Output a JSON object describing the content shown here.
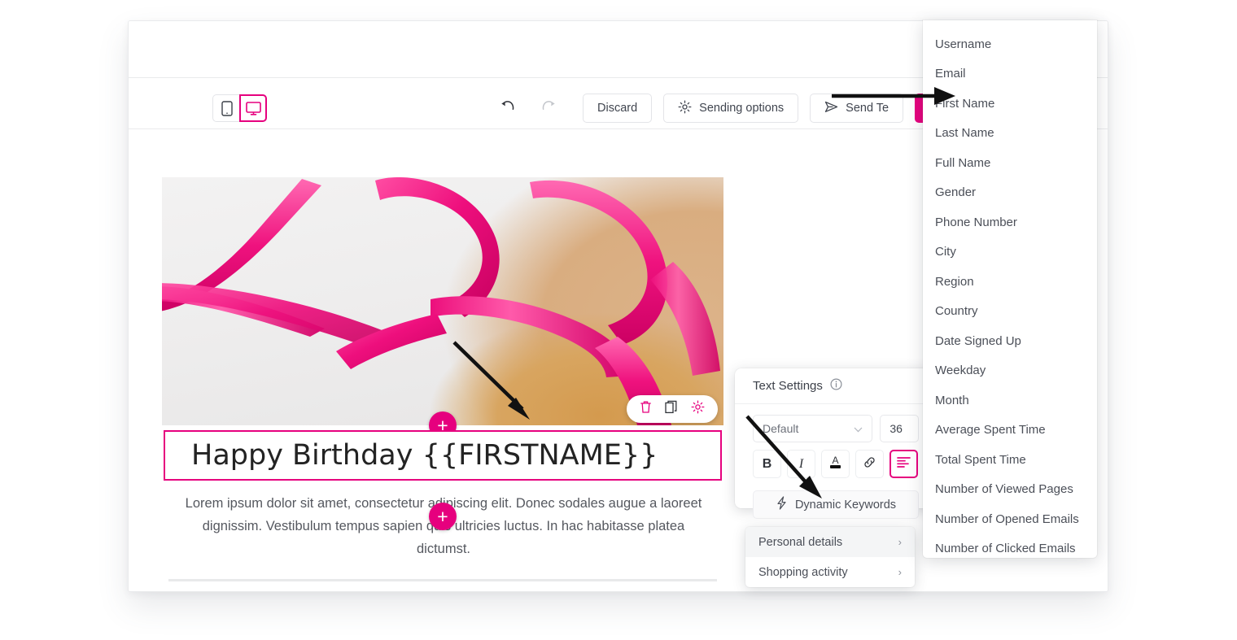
{
  "toolbar": {
    "device_mobile_icon": "mobile-icon",
    "device_desktop_icon": "desktop-icon",
    "undo_icon": "undo-arrow-icon",
    "redo_icon": "redo-arrow-icon",
    "discard_label": "Discard",
    "sending_options_label": "Sending options",
    "sending_options_icon": "gear-icon",
    "send_test_label": "Send Te",
    "send_test_icon": "send-paper-plane-icon"
  },
  "email": {
    "hero_image_alt": "gift box with pink ribbon",
    "headline": "Happy Birthday {{FIRSTNAME}}",
    "paragraph": "Lorem ipsum dolor sit amet, consectetur adipiscing elit. Donec sodales augue a laoreet dignissim. Vestibulum tempus sapien quis ultricies luctus. In hac habitasse platea dictumst.",
    "add_block_label": "+",
    "float_tools": [
      "delete-icon",
      "duplicate-icon",
      "settings-gear-icon"
    ]
  },
  "text_settings": {
    "title": "Text Settings",
    "info_icon": "info-circle-icon",
    "font_family_value": "Default",
    "font_size_value": "36",
    "bold_label": "B",
    "italic_label": "I",
    "text_color_label": "A",
    "link_icon": "link-icon",
    "align_icon": "align-left-icon",
    "dynamic_keywords_label": "Dynamic Keywords",
    "dynamic_keywords_icon": "lightning-bolt-icon"
  },
  "dynamic_keywords_menu": {
    "items": [
      {
        "label": "Personal details",
        "chevron": "›",
        "hovered": true
      },
      {
        "label": "Shopping activity",
        "chevron": "›",
        "hovered": false
      }
    ]
  },
  "fields_menu": {
    "items": [
      {
        "label": "Username"
      },
      {
        "label": "Email"
      },
      {
        "label": "First Name"
      },
      {
        "label": "Last Name"
      },
      {
        "label": "Full Name"
      },
      {
        "label": "Gender"
      },
      {
        "label": "Phone Number"
      },
      {
        "label": "City"
      },
      {
        "label": "Region"
      },
      {
        "label": "Country"
      },
      {
        "label": "Date Signed Up"
      },
      {
        "label": "Weekday"
      },
      {
        "label": "Month"
      },
      {
        "label": "Average Spent Time"
      },
      {
        "label": "Total Spent Time"
      },
      {
        "label": "Number of Viewed Pages"
      },
      {
        "label": "Number of Opened Emails"
      },
      {
        "label": "Number of Clicked Emails"
      }
    ]
  },
  "colors": {
    "accent_pink": "#e6007e",
    "text_dark": "#3c4049",
    "text_muted": "#6d717a",
    "border": "#e7e8eb"
  }
}
